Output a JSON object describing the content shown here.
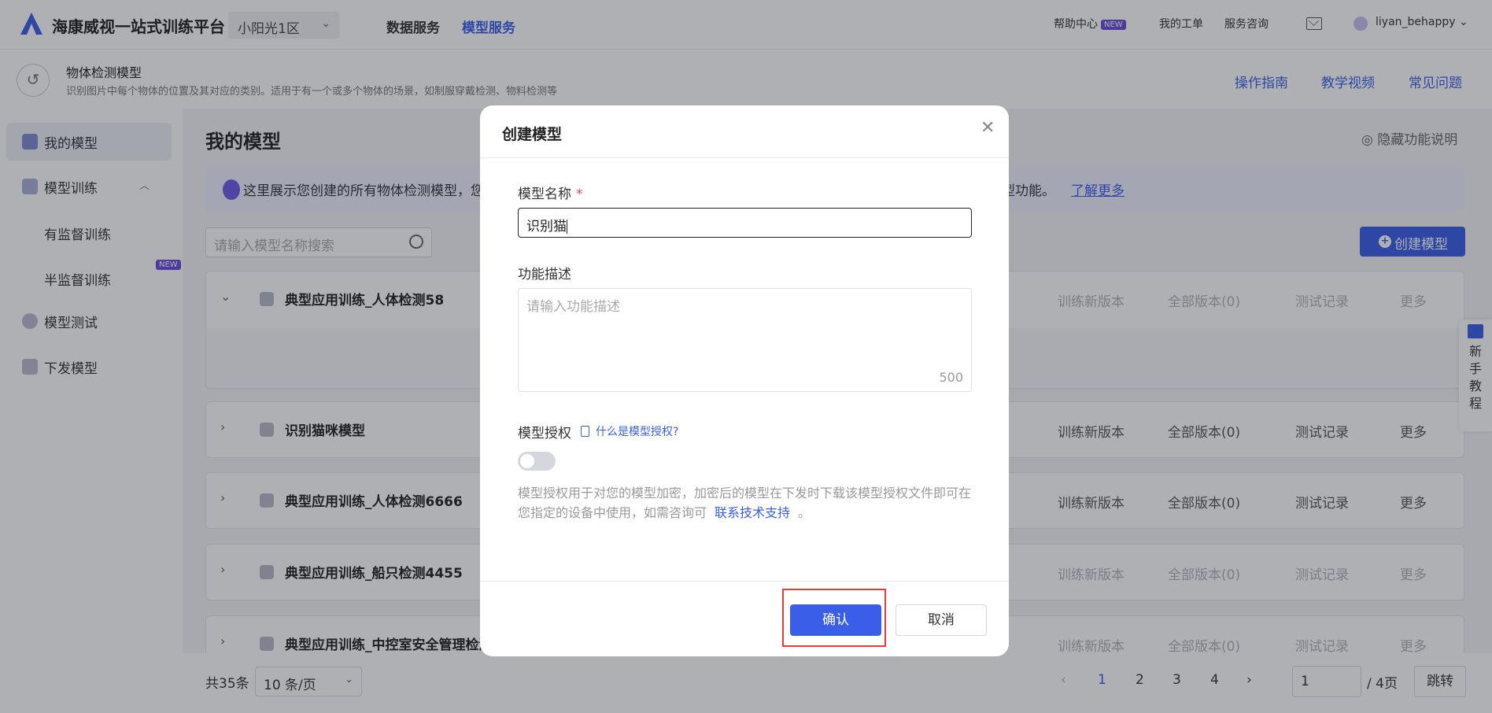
{
  "header": {
    "brand": "海康威视一站式训练平台",
    "region": "小阳光1区",
    "nav": [
      "数据服务",
      "模型服务"
    ],
    "help": "帮助中心",
    "help_badge": "NEW",
    "tickets": "我的工单",
    "consult": "服务咨询",
    "user": "liyan_behappy"
  },
  "subheader": {
    "title": "物体检测模型",
    "desc": "识别图片中每个物体的位置及其对应的类别。适用于有一个或多个物体的场景，如制服穿戴检测、物料检测等",
    "links": [
      "操作指南",
      "教学视频",
      "常见问题"
    ]
  },
  "sidebar": {
    "items": [
      "我的模型",
      "模型训练",
      "有监督训练",
      "半监督训练",
      "模型测试",
      "下发模型"
    ],
    "badge": "NEW"
  },
  "main": {
    "title": "我的模型",
    "hide_help": "隐藏功能说明",
    "banner_text": "这里展示您创建的所有物体检测模型，您",
    "banner_text2": "型功能。",
    "banner_link": "了解更多",
    "search_placeholder": "请输入模型名称搜索",
    "create_btn": "创建模型",
    "actions": [
      "训练新版本",
      "全部版本(0)",
      "测试记录",
      "更多"
    ],
    "rows": [
      "典型应用训练_人体检测58",
      "识别猫咪模型",
      "典型应用训练_人体检测6666",
      "典型应用训练_船只检测4455",
      "典型应用训练_中控室安全管理检测"
    ]
  },
  "pager": {
    "total": "共35条",
    "per_page": "10 条/页",
    "pages": [
      "1",
      "2",
      "3",
      "4"
    ],
    "current": "1",
    "jump_value": "1",
    "of": "/ 4页",
    "go": "跳转"
  },
  "tutorial": [
    "新",
    "手",
    "教",
    "程"
  ],
  "modal": {
    "title": "创建模型",
    "name_label": "模型名称",
    "required_mark": "*",
    "name_value": "识别猫",
    "desc_label": "功能描述",
    "desc_placeholder": "请输入功能描述",
    "desc_limit": "500",
    "auth_label": "模型授权",
    "auth_link": "什么是模型授权?",
    "auth_enabled": false,
    "auth_desc": "模型授权用于对您的模型加密，加密后的模型在下发时下载该模型授权文件即可在您指定的设备中使用，如需咨询可",
    "auth_support": "联系技术支持",
    "auth_end": "。",
    "confirm": "确认",
    "cancel": "取消"
  },
  "colors": {
    "accent": "#3a5ee8",
    "highlight_frame": "#e43b3b"
  }
}
